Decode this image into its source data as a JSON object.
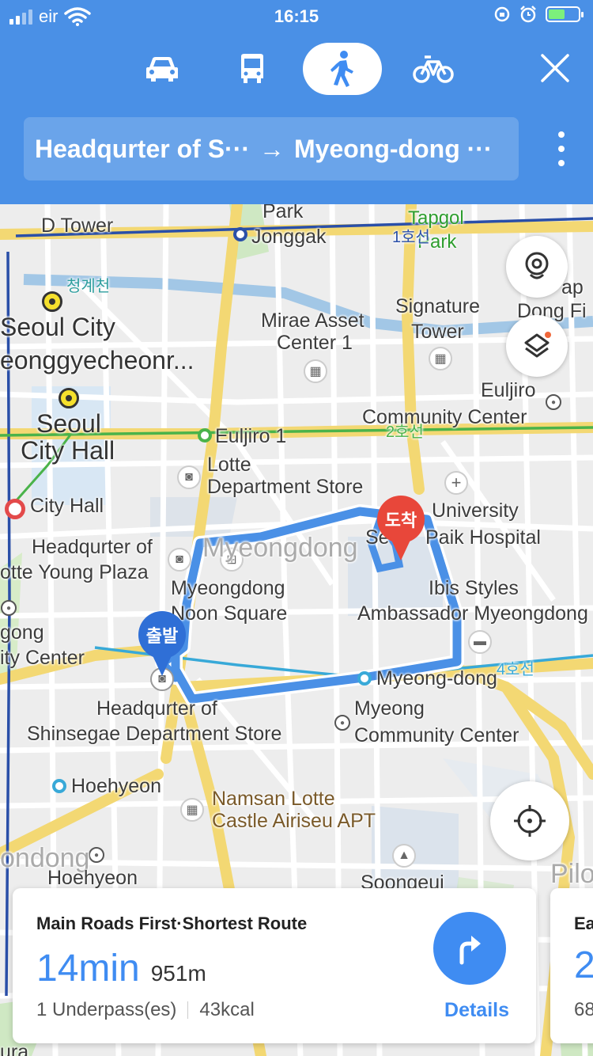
{
  "status": {
    "carrier": "eir",
    "time": "16:15"
  },
  "modes": [
    {
      "name": "car",
      "icon": "car-icon"
    },
    {
      "name": "bus",
      "icon": "bus-icon"
    },
    {
      "name": "walk",
      "icon": "walk-icon",
      "active": true
    },
    {
      "name": "bike",
      "icon": "bike-icon"
    }
  ],
  "route": {
    "origin": "Headqurter of S···",
    "arrow": "→",
    "destination": "Myeong-dong ···"
  },
  "map": {
    "labels": {
      "d_tower": "D Tower",
      "jonggak": "Jonggak",
      "park": "Park",
      "tapgol_park_1": "Tapgol",
      "tapgol_park_2": "Park",
      "line1": "1호선",
      "cheonggyecheon": "청계천",
      "seoul_city": "Seoul City",
      "cheonggyecheon_en": "eonggyecheonr...",
      "mirae_1": "Mirae Asset",
      "mirae_2": "Center 1",
      "signature_1": "Signature",
      "signature_2": "Tower",
      "map_1": "ap",
      "map_2": "Dong Fi",
      "euljiro_cc_1": "Euljiro",
      "euljiro_cc_2": "Community Center",
      "seoul_hall_1": "Seoul",
      "seoul_hall_2": "City Hall",
      "euljiro1": "Euljiro 1",
      "line2": "2호선",
      "lotte_1": "Lotte",
      "lotte_2": "Department Store",
      "city_hall": "City Hall",
      "univ_1": "University",
      "univ_2": "Paik Hospital",
      "univ_se": "Se",
      "hq_lotte_1": "Headqurter of",
      "hq_lotte_2": "otte Young Plaza",
      "myeongdong_faint": "Myeongdong",
      "noon_1": "Myeongdong",
      "noon_2": "Noon Square",
      "ibis_1": "Ibis Styles",
      "ibis_2": "Ambassador Myeongdong",
      "gong": "gong",
      "ity_center": "ity Center",
      "myeongdong_st": "Myeong-dong",
      "line4": "4호선",
      "hq_shin_1": "Headqurter of",
      "hq_shin_2": "Shinsegae Department Store",
      "myeong_cc_1": "Myeong",
      "myeong_cc_2": "Community Center",
      "hoehyeon": "Hoehyeon",
      "namsan_1": "Namsan Lotte",
      "namsan_2": "Castle Airiseu APT",
      "ondong": "ondong",
      "hoehyeon2": "Hoehyeon",
      "soongeui": "Soongeui",
      "pilo": "Pilo",
      "ura": "ura"
    },
    "start_pin": "출발",
    "end_pin": "도착"
  },
  "card": {
    "title": "Main Roads First·Shortest Route",
    "time": "14min",
    "distance": "951m",
    "underpass": "1 Underpass(es)",
    "kcal": "43kcal",
    "details": "Details"
  },
  "card2": {
    "title": "Ea",
    "time": "2",
    "meta": "68"
  },
  "colors": {
    "header": "#4a90e6",
    "accent": "#3f8cf2",
    "route": "#4a90e6",
    "start_pin": "#2f6fd6",
    "end_pin": "#e8473a"
  }
}
